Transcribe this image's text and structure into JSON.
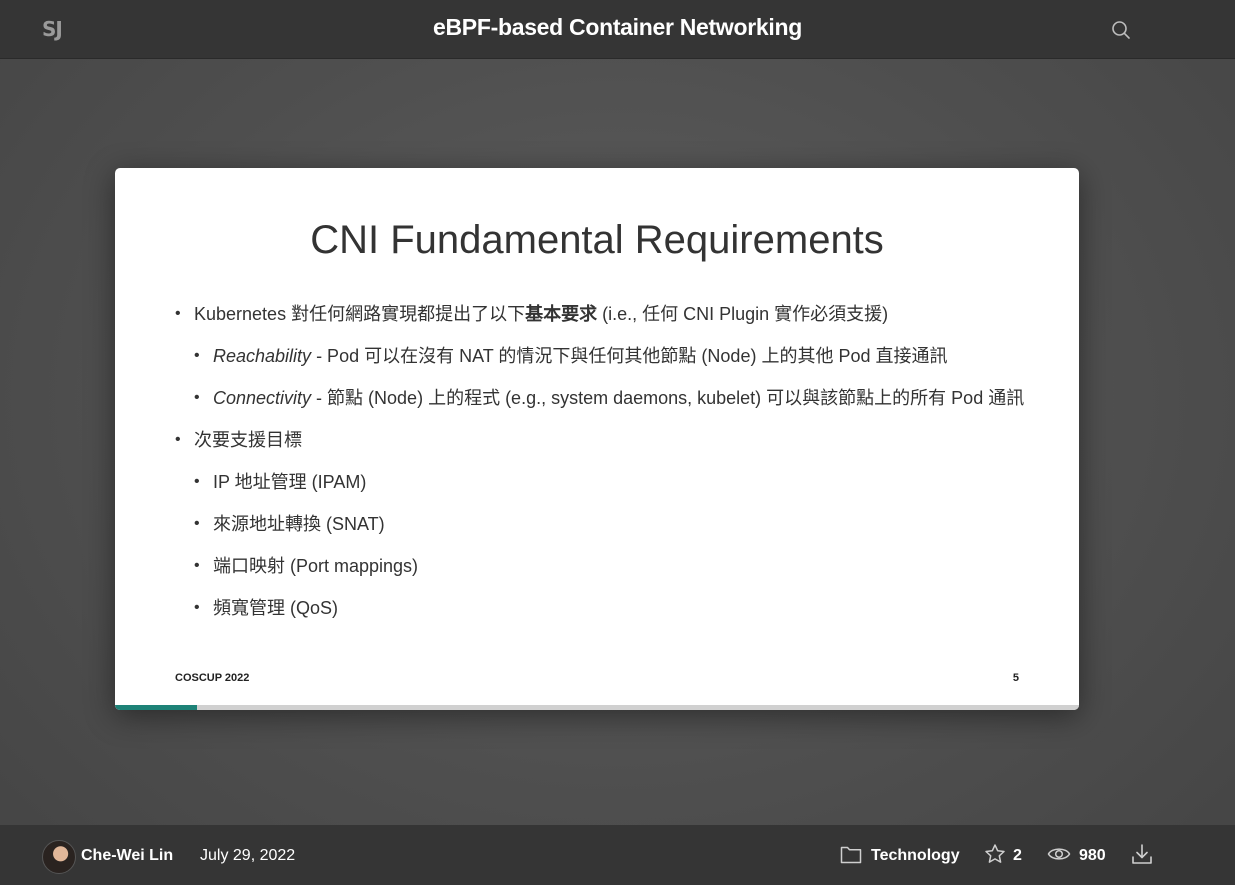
{
  "header": {
    "logo_text": "SJ",
    "deck_title": "eBPF-based Container Networking",
    "search_icon": "search-icon"
  },
  "slide": {
    "title": "CNI Fundamental Requirements",
    "bullets": [
      {
        "level": 1,
        "parts": [
          {
            "t": "Kubernetes 對任何網路實現都提出了以下"
          },
          {
            "t": "基本要求",
            "style": "strong"
          },
          {
            "t": " (i.e., 任何 CNI Plugin 實作必須支援)"
          }
        ]
      },
      {
        "level": 2,
        "parts": [
          {
            "t": "Reachability",
            "style": "em"
          },
          {
            "t": " - Pod 可以在沒有 NAT 的情況下與任何其他節點 (Node) 上的其他 Pod 直接通訊"
          }
        ]
      },
      {
        "level": 2,
        "parts": [
          {
            "t": "Connectivity",
            "style": "em"
          },
          {
            "t": " - 節點 (Node) 上的程式 (e.g., system daemons, kubelet) 可以與該節點上的所有 Pod 通訊"
          }
        ]
      },
      {
        "level": 1,
        "parts": [
          {
            "t": "次要支援目標"
          }
        ]
      },
      {
        "level": 2,
        "parts": [
          {
            "t": "IP 地址管理 (IPAM)"
          }
        ]
      },
      {
        "level": 2,
        "parts": [
          {
            "t": "來源地址轉換 (SNAT)"
          }
        ]
      },
      {
        "level": 2,
        "parts": [
          {
            "t": "端口映射 (Port mappings)"
          }
        ]
      },
      {
        "level": 2,
        "parts": [
          {
            "t": "頻寬管理 (QoS)"
          }
        ]
      }
    ],
    "footer_left": "COSCUP 2022",
    "footer_right": "5",
    "progress_fraction": 0.085,
    "progress_color": "#1d8277"
  },
  "footer": {
    "author": "Che-Wei Lin",
    "date": "July 29, 2022",
    "category": "Technology",
    "stars": "2",
    "views": "980",
    "icons": [
      "folder-icon",
      "star-icon",
      "eye-icon",
      "download-icon"
    ]
  }
}
